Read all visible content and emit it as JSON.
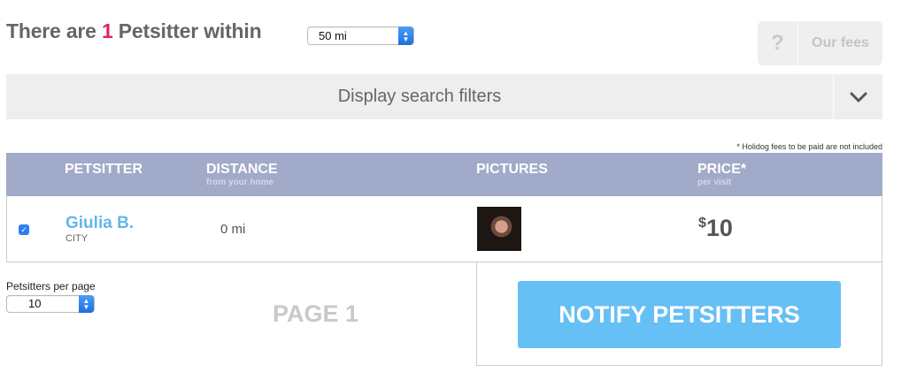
{
  "header": {
    "prefix": "There are",
    "count": "1",
    "suffix": "Petsitter within",
    "radius_value": "50 mi"
  },
  "fees": {
    "icon": "?",
    "label": "Our fees"
  },
  "filters": {
    "label": "Display search filters",
    "icon": "chevron-down-icon"
  },
  "note": "* Holidog fees to be paid are not included",
  "table": {
    "columns": [
      {
        "label": "PETSITTER",
        "sub": ""
      },
      {
        "label": "DISTANCE",
        "sub": "from your home"
      },
      {
        "label": "PICTURES",
        "sub": ""
      },
      {
        "label": "PRICE*",
        "sub": "per visit"
      }
    ],
    "rows": [
      {
        "checked": true,
        "name": "Giulia B.",
        "city": "CITY",
        "distance": "0 mi",
        "currency": "$",
        "price": "10"
      }
    ]
  },
  "pagination": {
    "per_page_label": "Petsitters per page",
    "per_page_value": "10",
    "page_label": "PAGE 1"
  },
  "notify_button": "NOTIFY PETSITTERS",
  "colors": {
    "accent": "#e0245e",
    "header_bg": "#a1aac9",
    "name": "#64b7ea",
    "notify_bg": "#66bff5"
  }
}
